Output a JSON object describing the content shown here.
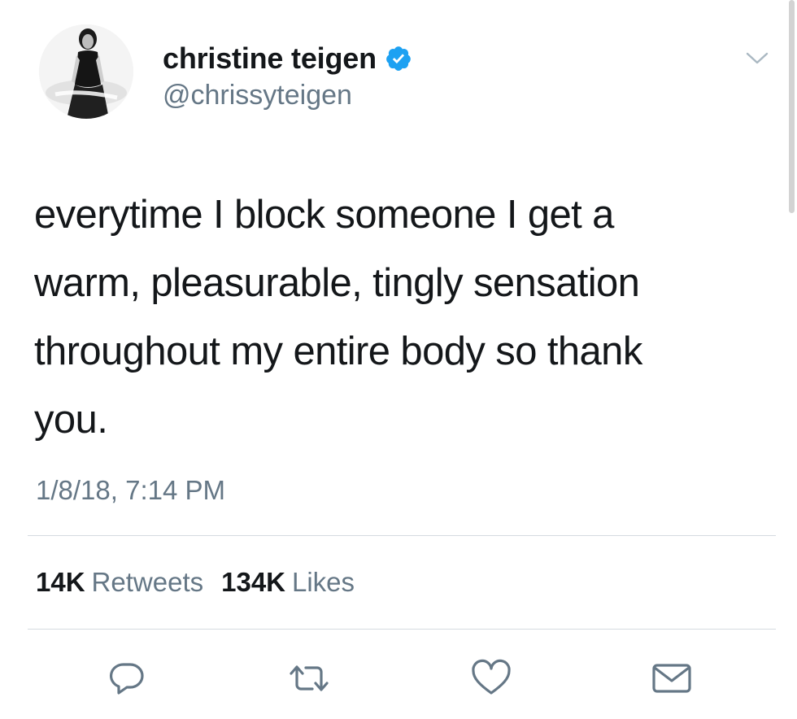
{
  "author": {
    "display_name": "christine teigen",
    "handle": "@chrissyteigen",
    "verified_icon": "verified-badge-icon",
    "colors": {
      "verified": "#1da1f2"
    }
  },
  "tweet": {
    "lines": [
      "everytime I block someone I get a",
      "warm, pleasurable, tingly sensation",
      "throughout my entire body so thank",
      "you."
    ],
    "timestamp": "1/8/18, 7:14 PM"
  },
  "stats": {
    "retweets_count": "14K",
    "retweets_label": "Retweets",
    "likes_count": "134K",
    "likes_label": "Likes"
  },
  "actions": {
    "icons": [
      "reply-icon",
      "retweet-icon",
      "like-icon",
      "dm-icon"
    ]
  },
  "menu": {
    "icon": "chevron-down-icon"
  }
}
